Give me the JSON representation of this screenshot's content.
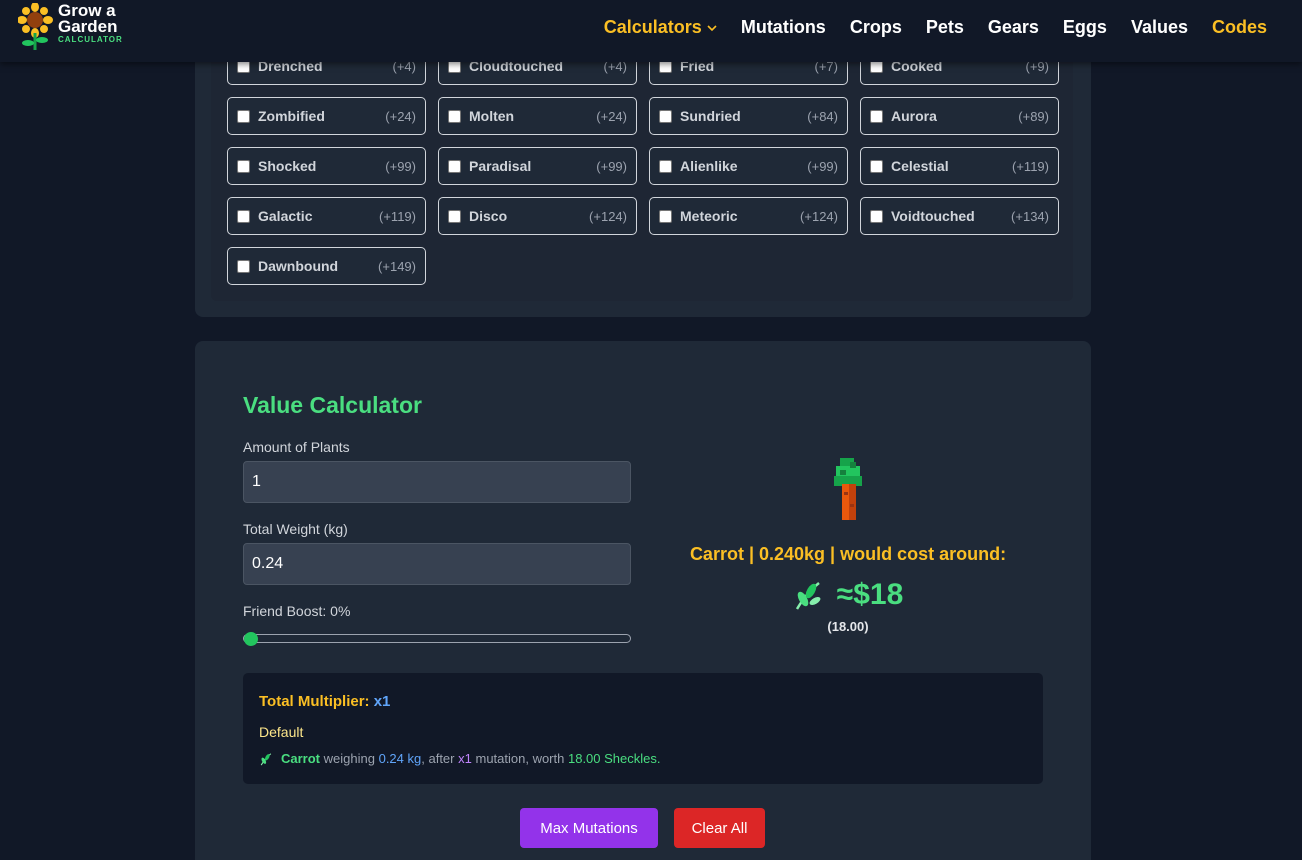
{
  "header": {
    "logo": {
      "line1": "Grow a",
      "line2": "Garden",
      "sub": "CALCULATOR"
    },
    "nav": [
      {
        "label": "Calculators",
        "highlight": true,
        "dropdown": true
      },
      {
        "label": "Mutations"
      },
      {
        "label": "Crops"
      },
      {
        "label": "Pets"
      },
      {
        "label": "Gears"
      },
      {
        "label": "Eggs"
      },
      {
        "label": "Values"
      },
      {
        "label": "Codes",
        "highlight": true
      }
    ]
  },
  "mutations": [
    {
      "name": "Drenched",
      "bonus": "(+4)"
    },
    {
      "name": "Cloudtouched",
      "bonus": "(+4)"
    },
    {
      "name": "Fried",
      "bonus": "(+7)"
    },
    {
      "name": "Cooked",
      "bonus": "(+9)"
    },
    {
      "name": "Zombified",
      "bonus": "(+24)"
    },
    {
      "name": "Molten",
      "bonus": "(+24)"
    },
    {
      "name": "Sundried",
      "bonus": "(+84)"
    },
    {
      "name": "Aurora",
      "bonus": "(+89)"
    },
    {
      "name": "Shocked",
      "bonus": "(+99)"
    },
    {
      "name": "Paradisal",
      "bonus": "(+99)"
    },
    {
      "name": "Alienlike",
      "bonus": "(+99)"
    },
    {
      "name": "Celestial",
      "bonus": "(+119)"
    },
    {
      "name": "Galactic",
      "bonus": "(+119)"
    },
    {
      "name": "Disco",
      "bonus": "(+124)"
    },
    {
      "name": "Meteoric",
      "bonus": "(+124)"
    },
    {
      "name": "Voidtouched",
      "bonus": "(+134)"
    },
    {
      "name": "Dawnbound",
      "bonus": "(+149)"
    }
  ],
  "calculator": {
    "title": "Value Calculator",
    "amount_label": "Amount of Plants",
    "amount_value": "1",
    "weight_label": "Total Weight (kg)",
    "weight_value": "0.24",
    "friend_boost_label": "Friend Boost: 0%",
    "friend_boost_percent": 0,
    "result_text": "Carrot | 0.240kg | would cost around:",
    "price": "≈$18",
    "price_exact": "(18.00)",
    "summary": {
      "total_label": "Total Multiplier:",
      "total_value": "x1",
      "mode": "Default",
      "crop": "Carrot",
      "weighing": "weighing",
      "weight": "0.24 kg",
      "after": ", after",
      "mult": "x1",
      "mutation_worth": "mutation, worth",
      "worth": "18.00 Sheckles."
    },
    "max_button": "Max Mutations",
    "clear_button": "Clear All"
  },
  "colors": {
    "accent_green": "#4ade80",
    "accent_yellow": "#fbbf24",
    "max_button": "#9333ea",
    "clear_button": "#dc2626"
  }
}
